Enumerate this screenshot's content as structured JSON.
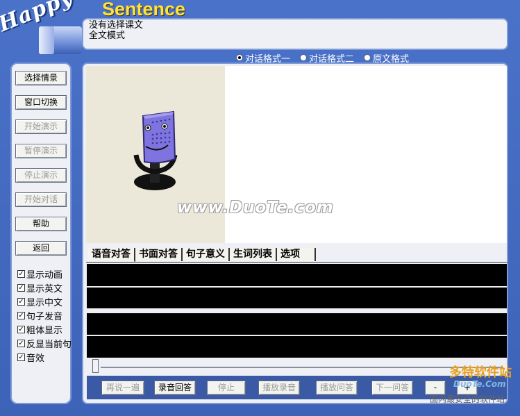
{
  "logo": {
    "happy": "Happy",
    "sentence": "Sentence"
  },
  "info": {
    "line1": "没有选择课文",
    "line2": "全文模式"
  },
  "format_options": [
    {
      "label": "对话格式一",
      "selected": true
    },
    {
      "label": "对话格式二",
      "selected": false
    },
    {
      "label": "原文格式",
      "selected": false
    }
  ],
  "sidebar": {
    "buttons": [
      {
        "label": "选择情景",
        "enabled": true
      },
      {
        "label": "窗口切换",
        "enabled": true
      },
      {
        "label": "开始演示",
        "enabled": false
      },
      {
        "label": "暂停演示",
        "enabled": false
      },
      {
        "label": "停止演示",
        "enabled": false
      },
      {
        "label": "开始对话",
        "enabled": false
      },
      {
        "label": "帮助",
        "enabled": true
      },
      {
        "label": "返回",
        "enabled": true
      }
    ],
    "checks": [
      {
        "label": "显示动画",
        "checked": true
      },
      {
        "label": "显示英文",
        "checked": true
      },
      {
        "label": "显示中文",
        "checked": true
      },
      {
        "label": "句子发音",
        "checked": true
      },
      {
        "label": "粗体显示",
        "checked": true
      },
      {
        "label": "反显当前句",
        "checked": true
      },
      {
        "label": "音效",
        "checked": true
      }
    ]
  },
  "tabs": [
    "语音对答",
    "书面对答",
    "句子意义",
    "生词列表",
    "选项"
  ],
  "watermark": {
    "main": "www.DuoTe.com",
    "corner_top": "多特软件站",
    "corner_mid": "DuoTe.Com",
    "corner_bottom": "国内最安全的软件站"
  },
  "bottom_buttons": [
    {
      "label": "再说一遍",
      "enabled": false
    },
    {
      "label": "录音回答",
      "enabled": true
    },
    {
      "label": "停止",
      "enabled": false
    },
    {
      "label": "播放录音",
      "enabled": false
    },
    {
      "label": "播放问答",
      "enabled": false
    },
    {
      "label": "下一问答",
      "enabled": false
    },
    {
      "label": "-",
      "enabled": true
    },
    {
      "label": "+",
      "enabled": true
    }
  ],
  "colors": {
    "background": "#4a72c8",
    "panel": "#eef0f5",
    "accent": "#ffe23a"
  }
}
